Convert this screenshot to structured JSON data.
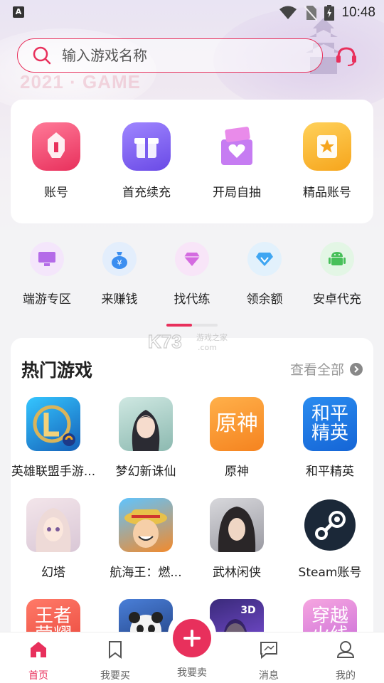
{
  "status_bar": {
    "time": "10:48"
  },
  "hero": {
    "watermark": "2021 · GAME"
  },
  "search": {
    "placeholder": "输入游戏名称"
  },
  "categories": [
    {
      "label": "账号",
      "icon": "helmet-icon",
      "color": "#f2466f"
    },
    {
      "label": "首充续充",
      "icon": "gift-box-icon",
      "color": "#7a5cf0"
    },
    {
      "label": "开局自抽",
      "icon": "gift-heart-icon",
      "color": "#b25ae8"
    },
    {
      "label": "精品账号",
      "icon": "star-card-icon",
      "color": "#f6a51c"
    }
  ],
  "shortcuts": [
    {
      "label": "端游专区",
      "icon": "monitor-icon",
      "color": "#b46be8"
    },
    {
      "label": "来赚钱",
      "icon": "money-bag-icon",
      "color": "#3b8ef0"
    },
    {
      "label": "找代练",
      "icon": "diamond-icon",
      "color": "#d46be0"
    },
    {
      "label": "领余额",
      "icon": "gem-icon",
      "color": "#3fa6f2"
    },
    {
      "label": "安卓代充",
      "icon": "android-icon",
      "color": "#48c05a"
    }
  ],
  "site_watermark": {
    "main": "K73",
    "sub": "游戏之家",
    "domain": ".com"
  },
  "hot_games": {
    "title": "热门游戏",
    "see_all": "查看全部",
    "items": [
      {
        "name": "英雄联盟手游...",
        "icon": "lol-icon"
      },
      {
        "name": "梦幻新诛仙",
        "icon": "fairy-girl-icon"
      },
      {
        "name": "原神",
        "icon": "genshin-text-icon",
        "icon_text": "原神"
      },
      {
        "name": "和平精英",
        "icon": "peace-elite-text-icon",
        "icon_text": "和平精英"
      },
      {
        "name": "幻塔",
        "icon": "anime-girl-icon"
      },
      {
        "name": "航海王：燃...",
        "icon": "luffy-icon"
      },
      {
        "name": "武林闲侠",
        "icon": "swordsman-icon"
      },
      {
        "name": "Steam账号",
        "icon": "steam-icon"
      },
      {
        "name": "",
        "icon": "king-glory-text-icon",
        "icon_text": "王者荣耀"
      },
      {
        "name": "",
        "icon": "panda-icon"
      },
      {
        "name": "",
        "icon": "3d-game-icon"
      },
      {
        "name": "",
        "icon": "chuanyue-text-icon",
        "icon_text": "穿越火线"
      }
    ]
  },
  "bottom_nav": [
    {
      "label": "首页",
      "icon": "home-icon",
      "active": true
    },
    {
      "label": "我要买",
      "icon": "bookmark-icon",
      "active": false
    },
    {
      "label": "我要卖",
      "icon": "plus-icon",
      "active": false
    },
    {
      "label": "消息",
      "icon": "message-icon",
      "active": false
    },
    {
      "label": "我的",
      "icon": "profile-icon",
      "active": false
    }
  ],
  "colors": {
    "accent": "#e8305c"
  }
}
